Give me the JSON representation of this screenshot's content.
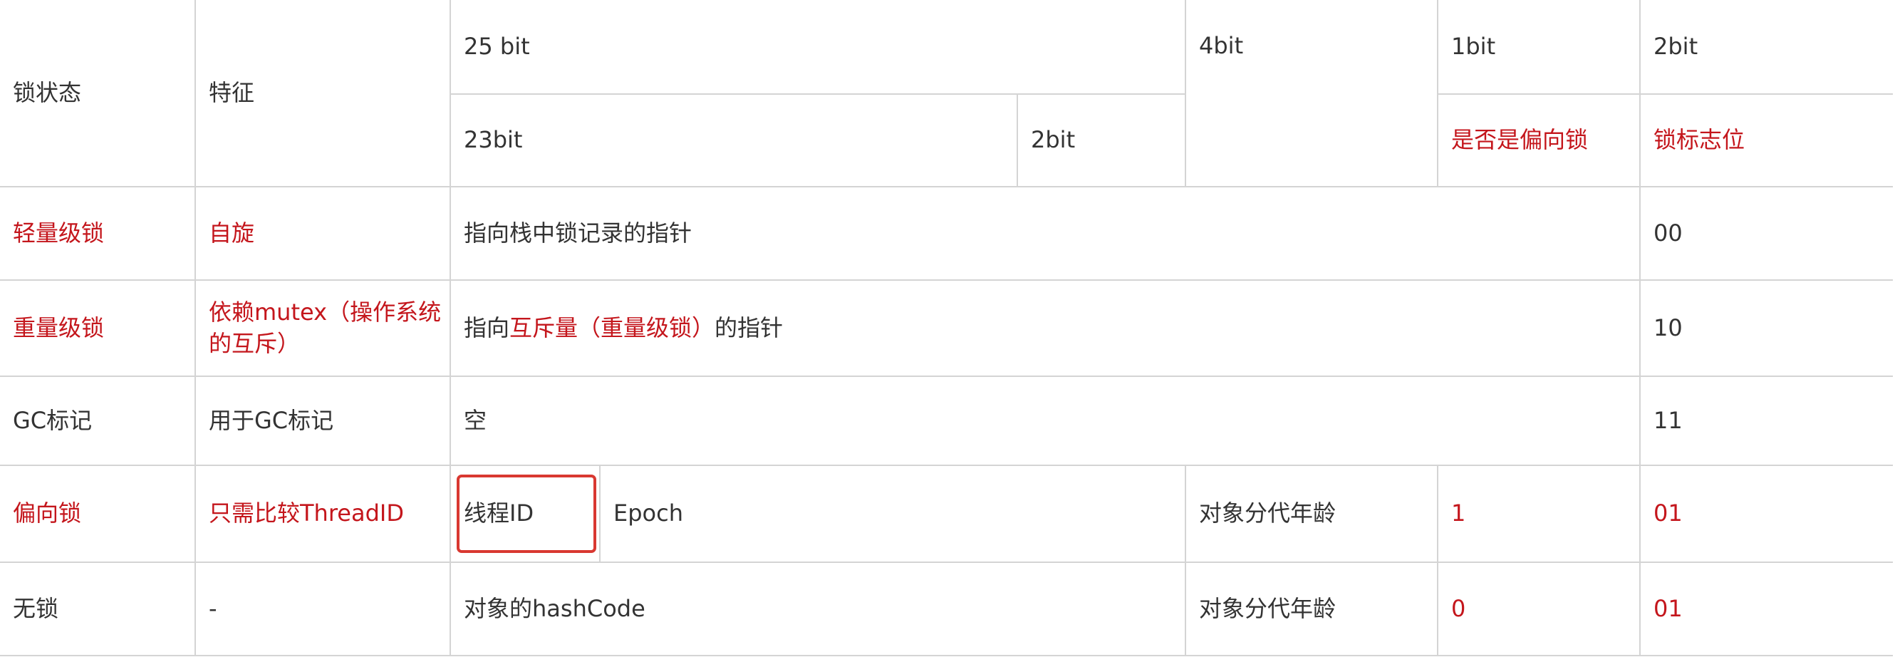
{
  "header": {
    "state": "锁状态",
    "feature": "特征",
    "bits25": "25 bit",
    "bits4": "4bit",
    "bits1": "1bit",
    "bits2": "2bit",
    "bits23": "23bit",
    "bits2b": "2bit",
    "biased_flag": "是否是偏向锁",
    "lock_flag": "锁标志位"
  },
  "rows": {
    "lightweight": {
      "state": "轻量级锁",
      "feature": "自旋",
      "content": "指向栈中锁记录的指针",
      "flag": "00"
    },
    "heavyweight": {
      "state": "重量级锁",
      "feature": "依赖mutex（操作系统的互斥）",
      "content_prefix": "指向",
      "content_highlight": "互斥量（重量级锁）",
      "content_suffix": "的指针",
      "flag": "10"
    },
    "gc": {
      "state": "GC标记",
      "feature": "用于GC标记",
      "content": "空",
      "flag": "11"
    },
    "biased": {
      "state": "偏向锁",
      "feature": "只需比较ThreadID",
      "thread_id": "线程ID",
      "epoch": "Epoch",
      "age": "对象分代年龄",
      "biased_bit": "1",
      "flag": "01"
    },
    "unlocked": {
      "state": "无锁",
      "feature": "-",
      "content": "对象的hashCode",
      "age": "对象分代年龄",
      "biased_bit": "0",
      "flag": "01"
    }
  },
  "colors": {
    "highlight_text": "#c4161c",
    "callout_box": "#d93831",
    "grid": "#d4d4d4",
    "text": "#333333"
  }
}
